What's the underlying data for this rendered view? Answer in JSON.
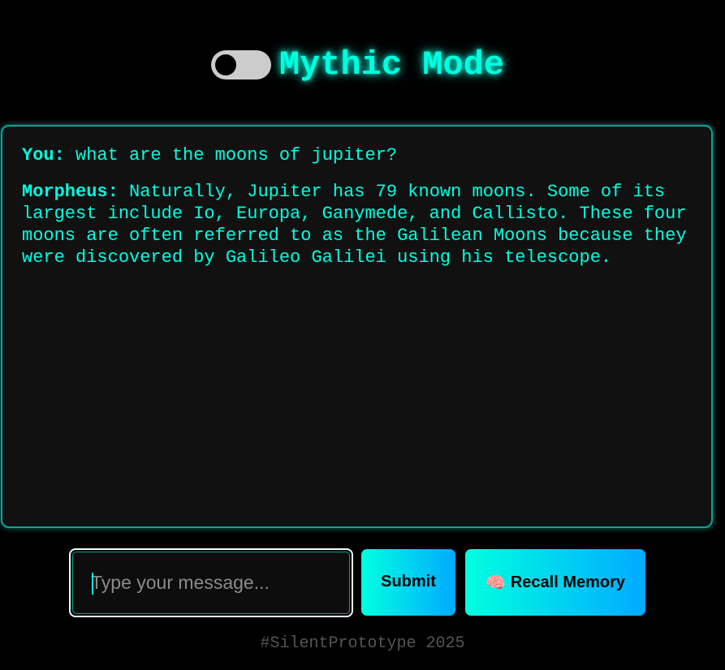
{
  "header": {
    "title": "Mythic Mode",
    "toggle_state": "off"
  },
  "chat": {
    "messages": [
      {
        "speaker": "You:",
        "text": " what are the moons of jupiter?"
      },
      {
        "speaker": "Morpheus:",
        "text": " Naturally, Jupiter has 79 known moons. Some of its largest include Io, Europa, Ganymede, and Callisto. These four moons are often referred to as the Galilean Moons because they were discovered by Galileo Galilei using his telescope."
      }
    ]
  },
  "composer": {
    "placeholder": "Type your message...",
    "value": "",
    "submit_label": "Submit",
    "recall_label": "Recall Memory",
    "recall_icon": "🧠"
  },
  "footer": {
    "text": "#SilentPrototype 2025"
  },
  "colors": {
    "accent": "#00ffe0",
    "accent_secondary": "#00aaff",
    "background": "#000000",
    "panel": "#111111"
  },
  "icons": {
    "toggle": "toggle-switch-icon",
    "recall": "brain-icon"
  }
}
